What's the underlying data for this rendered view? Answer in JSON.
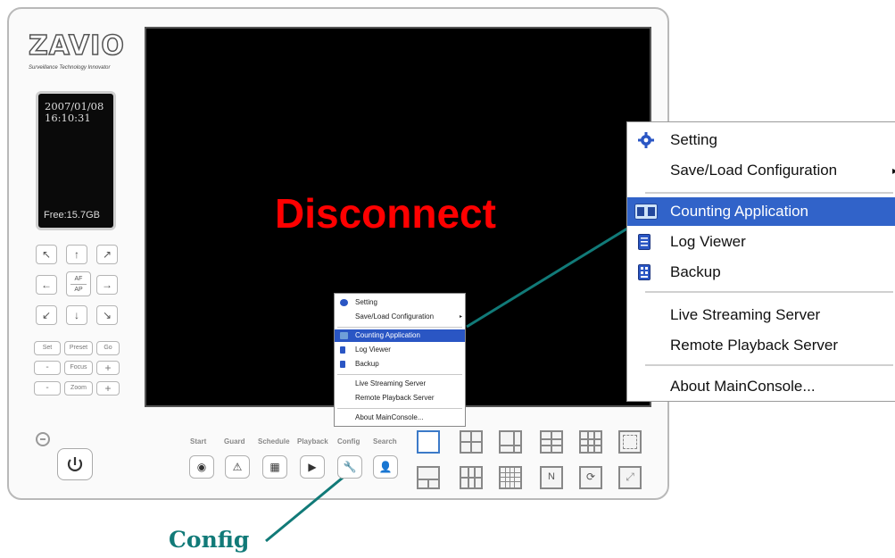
{
  "brand": {
    "logo": "ZAVIO",
    "tagline": "Surveillance Technology Innovator"
  },
  "status": {
    "date": "2007/01/08",
    "time": "16:10:31",
    "free": "Free:15.7GB"
  },
  "ptz": {
    "up_left": "↖",
    "up": "↑",
    "up_right": "↗",
    "left": "←",
    "af": "AF",
    "ap": "AP",
    "right": "→",
    "down_left": "↙",
    "down": "↓",
    "down_right": "↘",
    "set": "Set",
    "preset": "Preset",
    "go": "Go",
    "focus_minus": "-",
    "focus": "Focus",
    "focus_plus": "+",
    "zoom_minus": "-",
    "zoom": "Zoom",
    "zoom_plus": "+"
  },
  "video": {
    "status_text": "Disconnect"
  },
  "menu": {
    "setting": "Setting",
    "save_load": "Save/Load Configuration",
    "counting": "Counting Application",
    "log_viewer": "Log Viewer",
    "backup": "Backup",
    "live_streaming": "Live Streaming Server",
    "remote_playback": "Remote Playback Server",
    "about": "About MainConsole..."
  },
  "controls": {
    "start": "Start",
    "guard": "Guard",
    "schedule": "Schedule",
    "playback": "Playback",
    "config": "Config",
    "search": "Search"
  },
  "caption": "Config",
  "colors": {
    "highlight": "#3163c9",
    "callout": "#117a78",
    "disconnect": "#ff0000"
  }
}
